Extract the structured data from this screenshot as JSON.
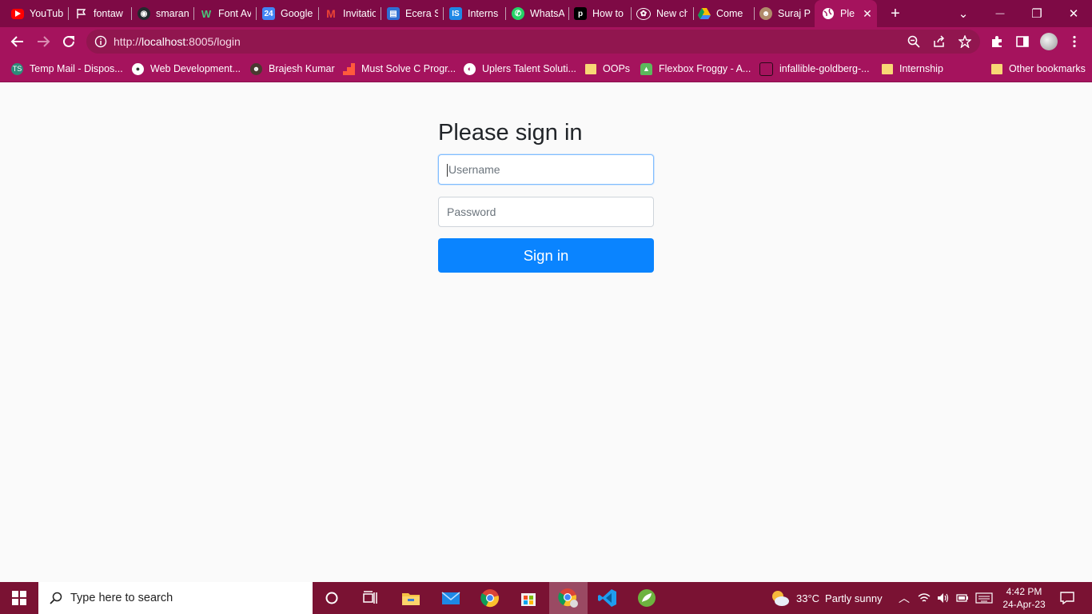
{
  "browser": {
    "tabs": [
      {
        "title": "YouTub",
        "icon": "youtube-icon",
        "color": "#ff0000"
      },
      {
        "title": "fontaw",
        "icon": "flag-icon",
        "color": "#7e0a45"
      },
      {
        "title": "smaran",
        "icon": "github-icon",
        "color": "#24292e"
      },
      {
        "title": "Font Av",
        "icon": "w-logo-icon",
        "color": "#7e0a45"
      },
      {
        "title": "Google",
        "icon": "calendar-icon",
        "color": "#4285f4"
      },
      {
        "title": "Invitatio",
        "icon": "gmail-icon",
        "color": "#7e0a45"
      },
      {
        "title": "Ecera S",
        "icon": "ecera-icon",
        "color": "#2f6fd3"
      },
      {
        "title": "Interns",
        "icon": "is-icon",
        "color": "#1e88e5"
      },
      {
        "title": "WhatsA",
        "icon": "whatsapp-icon",
        "color": "#25d366"
      },
      {
        "title": "How to",
        "icon": "p-logo-icon",
        "color": "#000000"
      },
      {
        "title": "New ch",
        "icon": "openai-icon",
        "color": "#7e0a45"
      },
      {
        "title": "Come",
        "icon": "drive-icon",
        "color": "#7e0a45"
      },
      {
        "title": "Suraj P",
        "icon": "avatar-icon",
        "color": "#b08a6a"
      },
      {
        "title": "Ple",
        "icon": "globe-icon",
        "color": "#ffffff",
        "active": true
      }
    ],
    "new_tab_symbol": "+",
    "window_controls": {
      "dropdown": "⌄",
      "minimize": "—",
      "restore": "❐",
      "close": "✕"
    },
    "address": {
      "scheme": "http://",
      "host": "localhost",
      "rest": ":8005/login"
    },
    "bookmarks": [
      {
        "label": "Temp Mail - Dispos...",
        "icon": "tempmail-icon"
      },
      {
        "label": "Web Development...",
        "icon": "webdev-icon"
      },
      {
        "label": "Brajesh Kumar",
        "icon": "avatar-icon"
      },
      {
        "label": "Must Solve C Progr...",
        "icon": "stairs-icon"
      },
      {
        "label": "Uplers Talent Soluti...",
        "icon": "globe-icon"
      },
      {
        "label": "OOPs",
        "icon": "folder-icon"
      },
      {
        "label": "Flexbox Froggy - A...",
        "icon": "frog-icon"
      },
      {
        "label": "infallible-goldberg-...",
        "icon": "square-icon"
      },
      {
        "label": "Internship",
        "icon": "folder-icon"
      },
      {
        "label": "Other bookmarks",
        "icon": "folder-icon"
      }
    ]
  },
  "login": {
    "title": "Please sign in",
    "username_placeholder": "Username",
    "password_placeholder": "Password",
    "submit_label": "Sign in",
    "accent": "#0a84ff"
  },
  "taskbar": {
    "search_placeholder": "Type here to search",
    "weather": {
      "temp": "33°C",
      "desc": "Partly sunny"
    },
    "time": "4:42 PM",
    "date": "24-Apr-23"
  }
}
